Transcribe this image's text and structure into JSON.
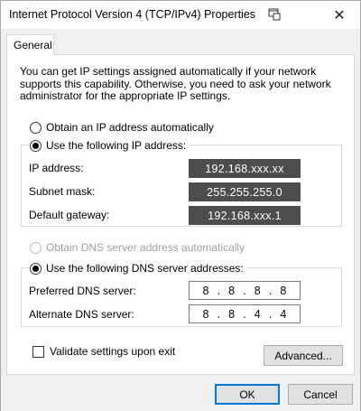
{
  "window": {
    "title": "Internet Protocol Version 4 (TCP/IPv4) Properties",
    "close_glyph": "✕"
  },
  "tabs": [
    {
      "label": "General"
    }
  ],
  "intro_text": "You can get IP settings assigned automatically if your network supports this capability. Otherwise, you need to ask your network administrator for the appropriate IP settings.",
  "ip_mode": {
    "auto_label": "Obtain an IP address automatically",
    "manual_label": "Use the following IP address:",
    "selected": "manual"
  },
  "ip_fields": {
    "ip_label": "IP address:",
    "ip_value": "192.168.xxx.xx",
    "mask_label": "Subnet mask:",
    "mask_value": "255.255.255.0",
    "gateway_label": "Default gateway:",
    "gateway_value": "192.168.xxx.1"
  },
  "dns_mode": {
    "auto_label": "Obtain DNS server address automatically",
    "manual_label": "Use the following DNS server addresses:",
    "selected": "manual"
  },
  "dns_fields": {
    "preferred_label": "Preferred DNS server:",
    "preferred_octets": [
      "8",
      "8",
      "8",
      "8"
    ],
    "alternate_label": "Alternate DNS server:",
    "alternate_octets": [
      "8",
      "8",
      "4",
      "4"
    ]
  },
  "validate": {
    "label": "Validate settings upon exit",
    "checked": false
  },
  "buttons": {
    "advanced": "Advanced...",
    "ok": "OK",
    "cancel": "Cancel"
  },
  "colors": {
    "accent": "#0078d7",
    "masked_field": "#4d4d4d"
  }
}
